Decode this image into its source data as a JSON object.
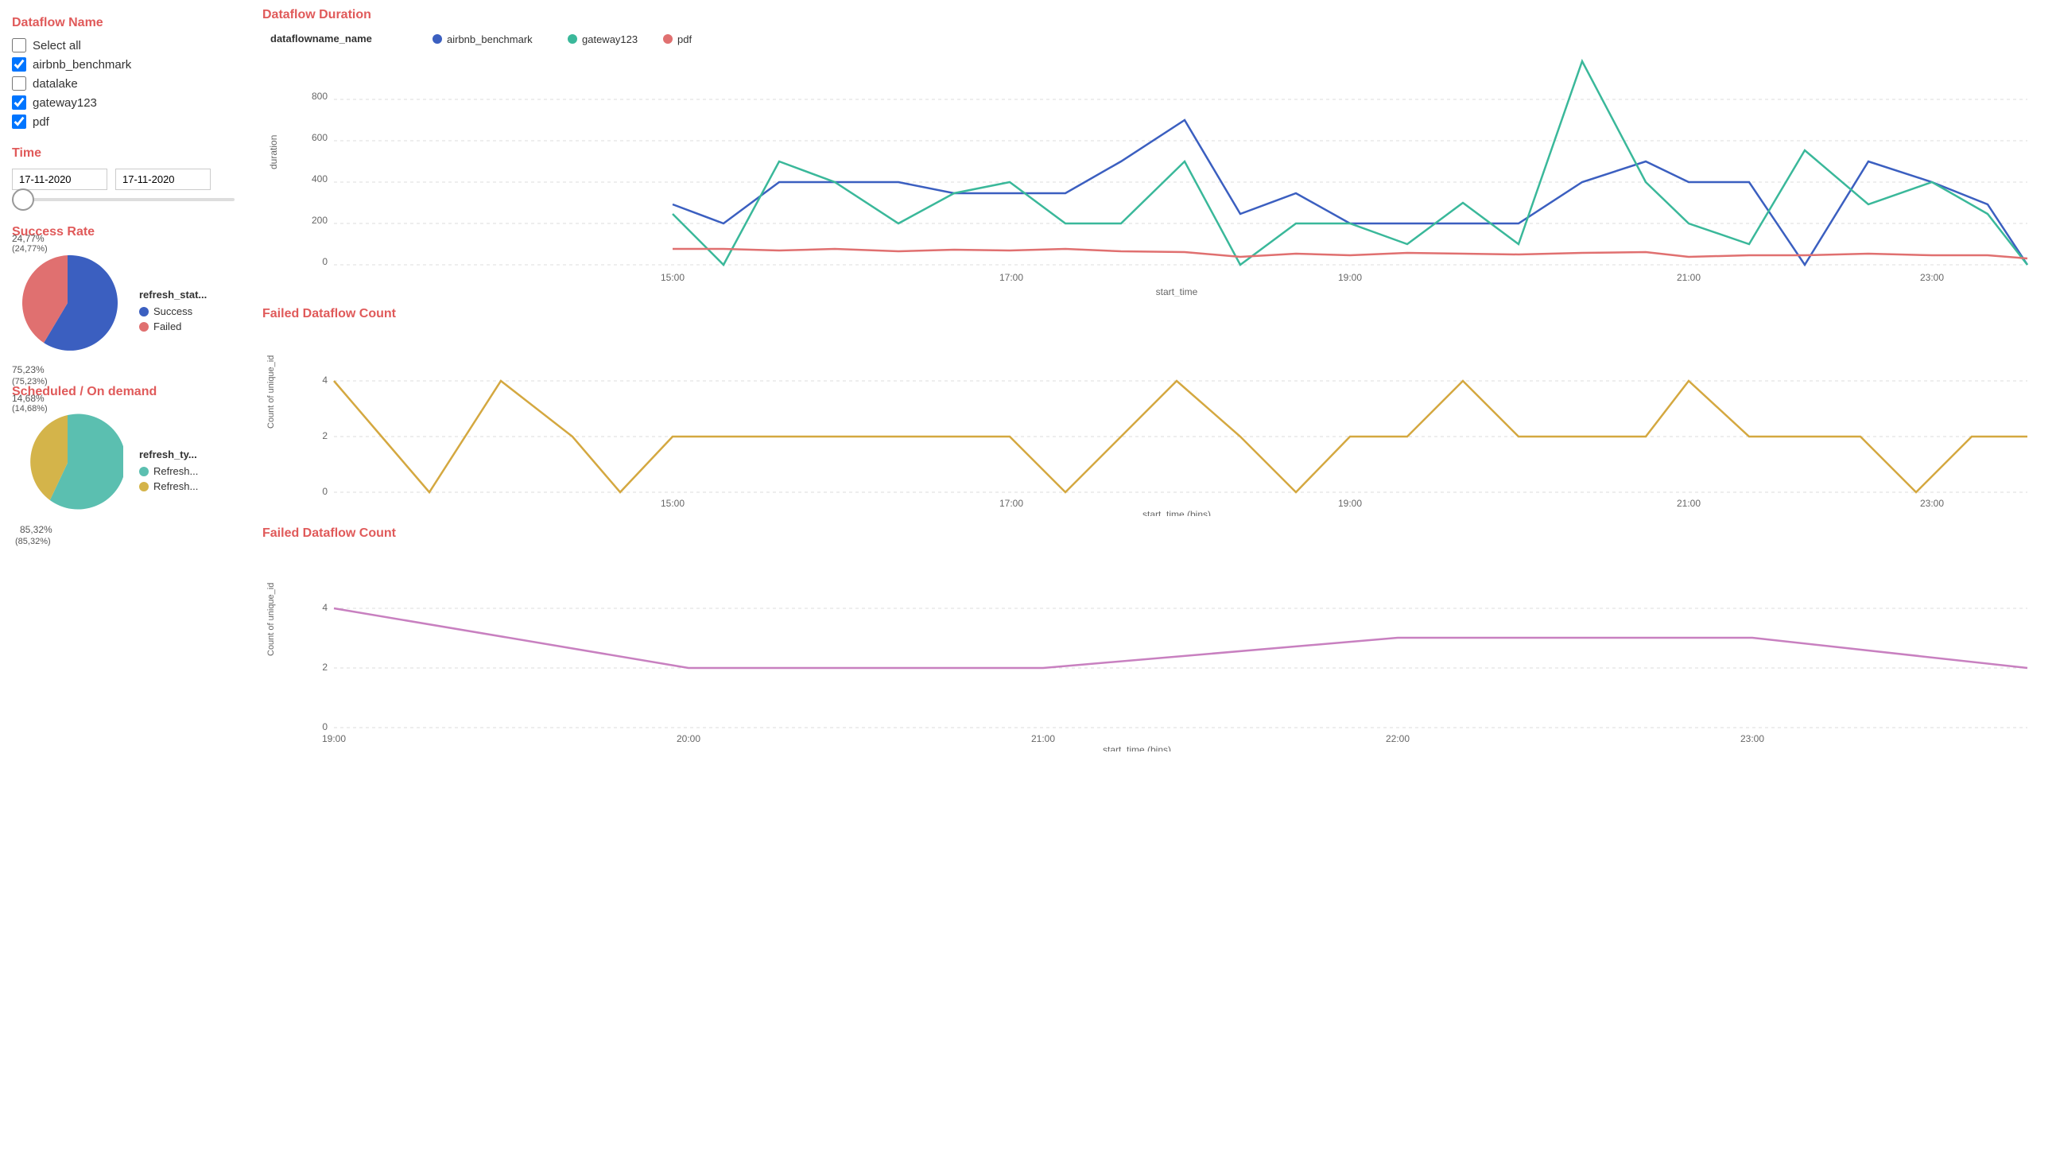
{
  "sidebar": {
    "dataflow_title": "Dataflow Name",
    "select_all_label": "Select all",
    "items": [
      {
        "label": "airbnb_benchmark",
        "checked": true
      },
      {
        "label": "datalake",
        "checked": false
      },
      {
        "label": "gateway123",
        "checked": true
      },
      {
        "label": "pdf",
        "checked": true
      }
    ],
    "time_title": "Time",
    "date_start": "17-11-2020",
    "date_end": "17-11-2020",
    "success_rate_title": "Success Rate",
    "success_legend_title": "refresh_stat...",
    "success_items": [
      {
        "label": "Success",
        "color": "#3b5fc0"
      },
      {
        "label": "Failed",
        "color": "#e07070"
      }
    ],
    "success_percent": "75,23%",
    "success_paren": "(75,23%)",
    "failed_percent": "24,77%",
    "failed_paren": "(24,77%)",
    "scheduled_title": "Scheduled / On demand",
    "scheduled_legend_title": "refresh_ty...",
    "scheduled_items": [
      {
        "label": "Refresh...",
        "color": "#5bbfb0"
      },
      {
        "label": "Refresh...",
        "color": "#d4b44a"
      }
    ],
    "scheduled_percent": "85,32%",
    "scheduled_paren": "(85,32%)",
    "ondemand_percent": "14,68%",
    "ondemand_paren": "(14,68%)"
  },
  "charts": {
    "duration_title": "Dataflow Duration",
    "duration_legend_label": "dataflowname_name",
    "duration_series": [
      {
        "name": "airbnb_benchmark",
        "color": "#3b5fc0"
      },
      {
        "name": "gateway123",
        "color": "#3ab89a"
      },
      {
        "name": "pdf",
        "color": "#e07070"
      }
    ],
    "duration_xaxis": "start_time",
    "duration_yaxis": "duration",
    "duration_yticks": [
      0,
      200,
      400,
      600,
      800
    ],
    "duration_xticks": [
      "15:00",
      "17:00",
      "19:00",
      "21:00",
      "23:00"
    ],
    "failed_count_title": "Failed Dataflow Count",
    "failed_xaxis": "start_time (bins)",
    "failed_yaxis": "Count of unique_id",
    "failed_yticks": [
      0,
      2,
      4
    ],
    "failed_xticks": [
      "15:00",
      "17:00",
      "19:00",
      "21:00",
      "23:00"
    ],
    "failed_count2_title": "Failed Dataflow Count",
    "failed2_xaxis": "start_time (bins)",
    "failed2_yaxis": "Count of unique_id",
    "failed2_yticks": [
      0,
      2,
      4
    ],
    "failed2_xticks": [
      "19:00",
      "20:00",
      "21:00",
      "22:00",
      "23:00"
    ]
  }
}
